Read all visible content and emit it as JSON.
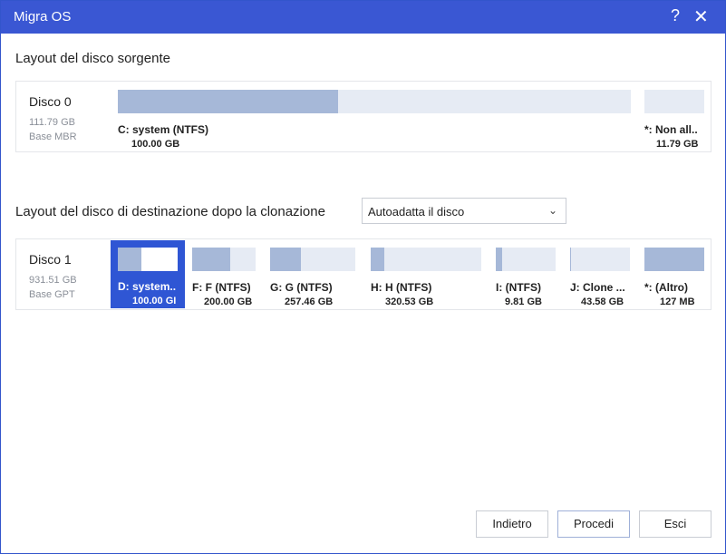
{
  "window": {
    "title": "Migra OS",
    "help_glyph": "?",
    "close_glyph": "✕"
  },
  "source": {
    "section_title": "Layout del disco sorgente",
    "disk": {
      "name": "Disco 0",
      "size": "111.79 GB",
      "type": "Base MBR"
    },
    "partitions": [
      {
        "name": "C: system (NTFS)",
        "size": "100.00 GB",
        "used_fraction": 0.43
      },
      {
        "name": "*: Non all..",
        "size": "11.79 GB",
        "unallocated": true
      }
    ]
  },
  "target": {
    "section_title": "Layout del disco di destinazione dopo la clonazione",
    "layout_mode": {
      "value": "Autoadatta il disco",
      "icon": "chevron-down-icon"
    },
    "disk": {
      "name": "Disco 1",
      "size": "931.51 GB",
      "type": "Base GPT"
    },
    "partitions": [
      {
        "name": "D: system..",
        "size": "100.00 GI",
        "used_fraction": 0.4,
        "selected": true
      },
      {
        "name": "F: F (NTFS)",
        "size": "200.00 GB",
        "used_fraction": 0.6
      },
      {
        "name": "G: G (NTFS)",
        "size": "257.46 GB",
        "used_fraction": 0.36
      },
      {
        "name": "H: H (NTFS)",
        "size": "320.53 GB",
        "used_fraction": 0.12
      },
      {
        "name": "I: (NTFS)",
        "size": "9.81 GB",
        "used_fraction": 0.1
      },
      {
        "name": "J: Clone ...",
        "size": "43.58 GB",
        "used_fraction": 0.02
      },
      {
        "name": "*: (Altro)",
        "size": "127 MB",
        "used_fraction": 1.0
      }
    ]
  },
  "buttons": {
    "back": "Indietro",
    "proceed": "Procedi",
    "cancel": "Esci"
  },
  "colors": {
    "titlebar": "#3a57d3",
    "selection": "#2f56d4",
    "used_fill": "#a6b8d8",
    "free_fill": "#e6ebf4"
  }
}
